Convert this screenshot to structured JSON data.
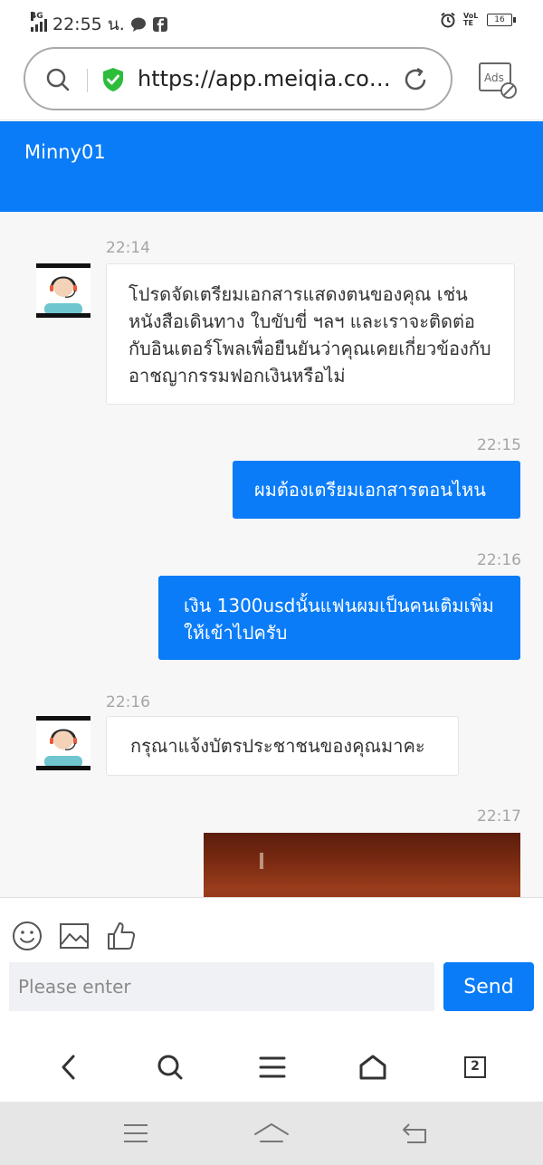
{
  "status_bar": {
    "network": "4G",
    "time": "22:55 น.",
    "volte": "VoLTE",
    "battery": "16"
  },
  "browser": {
    "url": "https://app.meiqia.com/...",
    "ads_label": "Ads"
  },
  "header": {
    "title": "Minny01"
  },
  "messages": [
    {
      "side": "in",
      "time": "22:14",
      "text": "โปรดจัดเตรียมเอกสารแสดงตนของคุณ เช่น หนังสือเดินทาง ใบขับขี่ ฯลฯ และเราจะติดต่อกับอินเตอร์โพลเพื่อยืนยันว่าคุณเคยเกี่ยวข้องกับอาชญากรรมฟอกเงินหรือไม่"
    },
    {
      "side": "out",
      "time": "22:15",
      "text": "ผมต้องเตรียมเอกสารตอนไหน"
    },
    {
      "side": "out",
      "time": "22:16",
      "text": "เงิน 1300usdนั้นแฟนผมเป็นคนเติมเพิ่มให้เข้าไปครับ"
    },
    {
      "side": "in",
      "time": "22:16",
      "text": "กรุณาแจ้งบัตรประชาชนของคุณมาคะ"
    },
    {
      "side": "out",
      "time": "22:17",
      "text": ""
    }
  ],
  "composer": {
    "placeholder": "Please enter",
    "send_label": "Send"
  },
  "tab_count": "2",
  "colors": {
    "accent": "#0a7cf8",
    "shield": "#2ebd3a"
  }
}
